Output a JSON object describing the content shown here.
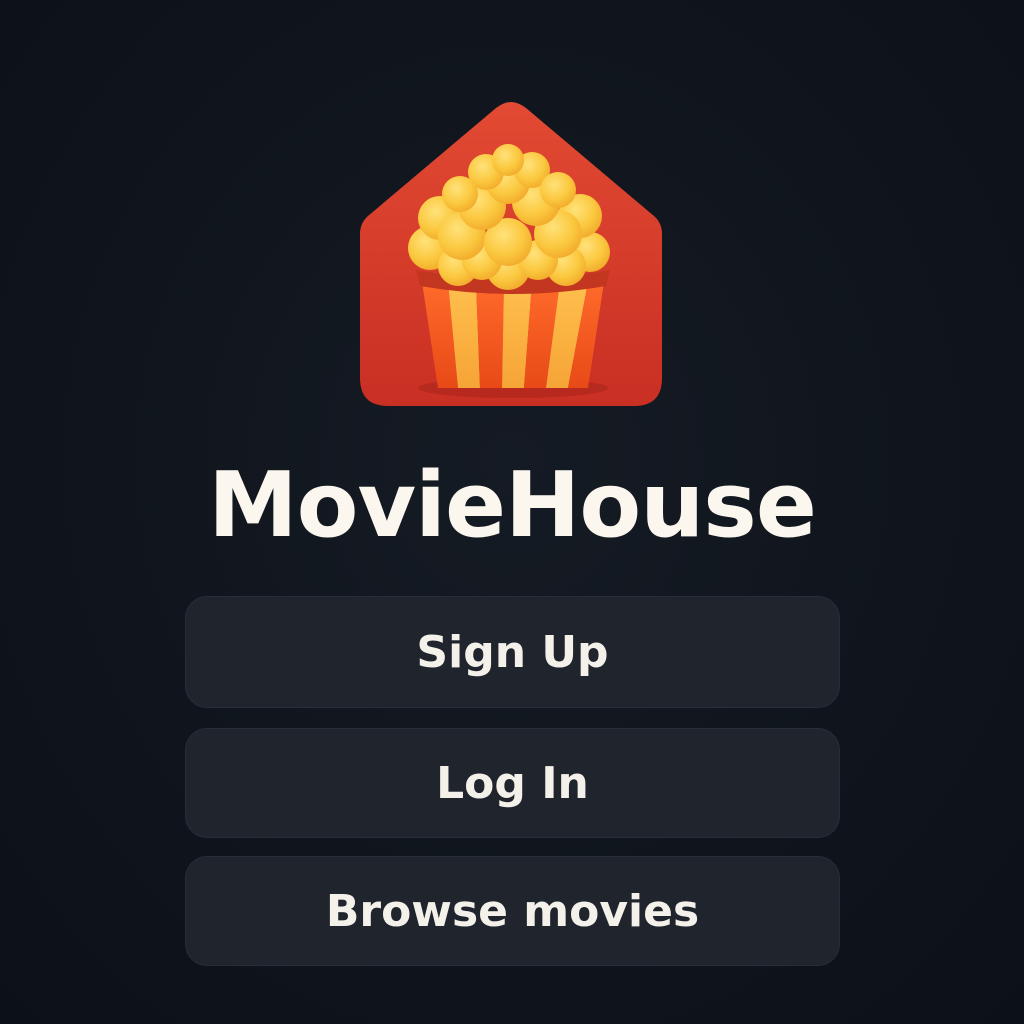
{
  "app": {
    "name": "MovieHouse",
    "logo_icon": "popcorn-house-icon",
    "colors": {
      "background": "#111720",
      "logo_red": "#d93a2c",
      "popcorn_yellow": "#f9c23c",
      "stripe_orange": "#ef5b1f",
      "button_bg": "#1f242d",
      "text": "#fbf6ee"
    }
  },
  "actions": {
    "sign_up": "Sign Up",
    "log_in": "Log In",
    "browse": "Browse movies"
  }
}
